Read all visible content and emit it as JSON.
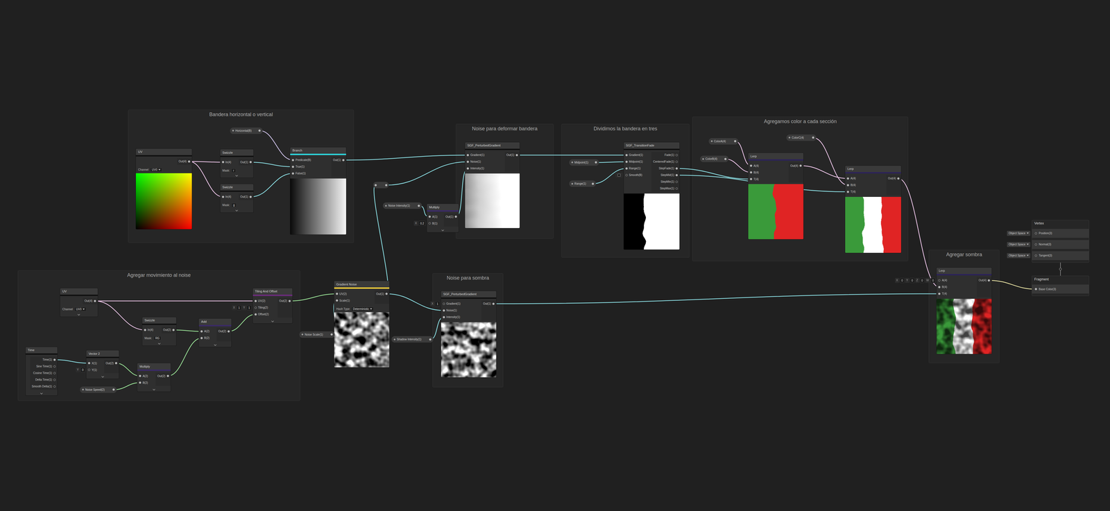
{
  "groups": [
    {
      "title": "Bandera horizontal o vertical"
    },
    {
      "title": "Noise para deformar bandera"
    },
    {
      "title": "Dividimos la bandera en tres"
    },
    {
      "title": "Agregamos color a cada sección"
    },
    {
      "title": "Agregar movimiento al noise"
    },
    {
      "title": "Noise para sombra"
    },
    {
      "title": "Agregar sombra"
    }
  ],
  "nodes": [
    {
      "kind": "node",
      "title": "UV",
      "strip": "#111111",
      "inputs": [],
      "outputs": [
        {
          "label": "Out(4)"
        }
      ],
      "fields": [
        {
          "label": "Channel",
          "value": "UV0",
          "dropdown": true
        }
      ],
      "preview": "uv"
    },
    {
      "kind": "node",
      "title": "Swizzle",
      "strip": "#111111",
      "inputs": [
        {
          "label": "In(4)"
        }
      ],
      "outputs": [
        {
          "label": "Out(1)"
        }
      ],
      "fields": [
        {
          "label": "Mask:",
          "value": "r",
          "dropdown": false
        }
      ],
      "preview": "none"
    },
    {
      "kind": "node",
      "title": "Swizzle",
      "strip": "#111111",
      "inputs": [
        {
          "label": "In(4)"
        }
      ],
      "outputs": [
        {
          "label": "Out(1)"
        }
      ],
      "fields": [
        {
          "label": "Mask:",
          "value": "g",
          "dropdown": false
        }
      ],
      "preview": "none"
    },
    {
      "kind": "node",
      "title": "Branch",
      "strip": "#2ed3d9",
      "inputs": [
        {
          "label": "Predicate(B)"
        },
        {
          "label": "True(1)"
        },
        {
          "label": "False(1)"
        }
      ],
      "outputs": [
        {
          "label": "Out(1)"
        }
      ],
      "fields": [],
      "preview": "hgradient"
    },
    {
      "kind": "property",
      "label": "Horizontal(B)"
    },
    {
      "kind": "node",
      "title": "SGF_PerturbedGradient",
      "strip": "#111111",
      "inputs": [
        {
          "label": "Gradient(1)"
        },
        {
          "label": "Noise(1)"
        },
        {
          "label": "Intensity(1)"
        }
      ],
      "outputs": [
        {
          "label": "Out(1)"
        }
      ],
      "fields": [],
      "preview": "perturbed"
    },
    {
      "kind": "property",
      "label": "Noise Intensity(1)"
    },
    {
      "kind": "node",
      "title": "Multiply",
      "strip": "#3a2a66",
      "inputs": [
        {
          "label": "A(1)"
        },
        {
          "label": "B(1)",
          "field": [
            "X",
            "0.2"
          ]
        }
      ],
      "outputs": [
        {
          "label": "Out(1)"
        }
      ],
      "fields": [],
      "preview": "none"
    },
    {
      "kind": "redirect"
    },
    {
      "kind": "property",
      "label": "Midpoint(1)"
    },
    {
      "kind": "property",
      "label": "Range(1)"
    },
    {
      "kind": "node",
      "title": "SGF_TransitionFade",
      "strip": "#111111",
      "inputs": [
        {
          "label": "Gradient(1)"
        },
        {
          "label": "Midpoint(1)"
        },
        {
          "label": "Range(1)"
        },
        {
          "label": "Smooth(B)",
          "check": false
        }
      ],
      "outputs": [
        {
          "label": "Fade(1)"
        },
        {
          "label": "CenteredFade(1)"
        },
        {
          "label": "StepFade(1)"
        },
        {
          "label": "StepMid(1)"
        },
        {
          "label": "StepMin(1)"
        },
        {
          "label": "StepMax(1)"
        }
      ],
      "fields": [],
      "preview": "step"
    },
    {
      "kind": "property",
      "label": "ColorA(4)"
    },
    {
      "kind": "property",
      "label": "ColorB(4)"
    },
    {
      "kind": "property",
      "label": "ColorC(4)"
    },
    {
      "kind": "node",
      "title": "Lerp",
      "strip": "#2c2358",
      "inputs": [
        {
          "label": "A(4)"
        },
        {
          "label": "B(4)"
        },
        {
          "label": "T(4)"
        }
      ],
      "outputs": [
        {
          "label": "Out(4)"
        }
      ],
      "fields": [],
      "preview": "lerp2"
    },
    {
      "kind": "node",
      "title": "Lerp",
      "strip": "#2c2358",
      "inputs": [
        {
          "label": "A(4)"
        },
        {
          "label": "B(4)"
        },
        {
          "label": "T(4)"
        }
      ],
      "outputs": [
        {
          "label": "Out(4)"
        }
      ],
      "fields": [],
      "preview": "flag"
    },
    {
      "kind": "node",
      "title": "UV",
      "strip": "#111111",
      "inputs": [],
      "outputs": [
        {
          "label": "Out(4)"
        }
      ],
      "fields": [
        {
          "label": "Channel",
          "value": "UV0",
          "dropdown": true
        }
      ],
      "preview": "none"
    },
    {
      "kind": "node",
      "title": "Swizzle",
      "strip": "#111111",
      "inputs": [
        {
          "label": "In(4)"
        }
      ],
      "outputs": [
        {
          "label": "Out(2)"
        }
      ],
      "fields": [
        {
          "label": "Mask:",
          "value": "RG",
          "dropdown": false
        }
      ],
      "preview": "none"
    },
    {
      "kind": "node",
      "title": "Time",
      "strip": "#111111",
      "inputs": [],
      "outputs": [
        {
          "label": "Time(1)"
        },
        {
          "label": "Sine Time(1)"
        },
        {
          "label": "Cosine Time(1)"
        },
        {
          "label": "Delta Time(1)"
        },
        {
          "label": "Smooth Delta(1)"
        }
      ],
      "fields": [],
      "preview": "none"
    },
    {
      "kind": "node",
      "title": "Vector 2",
      "strip": "#111111",
      "inputs": [
        {
          "label": "X(1)"
        },
        {
          "label": "Y(1)",
          "field": [
            "Y",
            "0"
          ]
        }
      ],
      "outputs": [
        {
          "label": "Out(2)"
        }
      ],
      "fields": [],
      "preview": "none"
    },
    {
      "kind": "node",
      "title": "Multiply",
      "strip": "#3a2a66",
      "inputs": [
        {
          "label": "A(2)"
        },
        {
          "label": "B(2)"
        }
      ],
      "outputs": [
        {
          "label": "Out(2)"
        }
      ],
      "fields": [],
      "preview": "none"
    },
    {
      "kind": "property",
      "label": "Noise Speed(2)"
    },
    {
      "kind": "node",
      "title": "Add",
      "strip": "#3a2a66",
      "inputs": [
        {
          "label": "A(2)"
        },
        {
          "label": "B(2)"
        }
      ],
      "outputs": [
        {
          "label": "Out(2)"
        }
      ],
      "fields": [],
      "preview": "none"
    },
    {
      "kind": "node",
      "title": "Tiling And Offset",
      "strip": "#6a2c7a",
      "inputs": [
        {
          "label": "UV(2)"
        },
        {
          "label": "Tiling(2)",
          "field": [
            "X",
            "1",
            "Y",
            "1"
          ]
        },
        {
          "label": "Offset(2)"
        }
      ],
      "outputs": [
        {
          "label": "Out(2)"
        }
      ],
      "fields": [],
      "preview": "none"
    },
    {
      "kind": "node",
      "title": "Gradient Noise",
      "strip": "#e8c53a",
      "inputs": [
        {
          "label": "UV(2)"
        },
        {
          "label": "Scale(1)"
        }
      ],
      "outputs": [
        {
          "label": "Out(1)"
        }
      ],
      "fields": [
        {
          "label": "Hash Type",
          "value": "Deterministic",
          "dropdown": true
        }
      ],
      "preview": "noise"
    },
    {
      "kind": "property",
      "label": "Noise Scale(1)"
    },
    {
      "kind": "node",
      "title": "SGF_PerturbedGradient",
      "strip": "#111111",
      "inputs": [
        {
          "label": "Gradient(1)",
          "field": [
            "X",
            "1"
          ]
        },
        {
          "label": "Noise(1)"
        },
        {
          "label": "Intensity(1)"
        }
      ],
      "outputs": [
        {
          "label": "Out(1)"
        }
      ],
      "fields": [],
      "preview": "noise"
    },
    {
      "kind": "property",
      "label": "Shadow Intensity(1)"
    },
    {
      "kind": "node",
      "title": "Lerp",
      "strip": "#2c2358",
      "inputs": [
        {
          "label": "A(4)",
          "field": [
            "X",
            "0",
            "Y",
            "0",
            "Z",
            "0",
            "W",
            "0"
          ]
        },
        {
          "label": "B(4)"
        },
        {
          "label": "T(4)"
        }
      ],
      "outputs": [
        {
          "label": "Out(4)"
        }
      ],
      "fields": [],
      "preview": "flagshadow"
    },
    {
      "kind": "stack",
      "title": "Vertex",
      "inputs": [
        {
          "label": "Position(3)",
          "field": [
            "Object Space"
          ]
        },
        {
          "label": "Normal(3)",
          "field": [
            "Object Space"
          ]
        },
        {
          "label": "Tangent(3)",
          "field": [
            "Object Space"
          ]
        }
      ]
    },
    {
      "kind": "stack",
      "title": "Fragment",
      "inputs": [
        {
          "label": "Base Color(3)"
        }
      ]
    }
  ],
  "edges": [
    {
      "from": [
        0,
        0
      ],
      "to": [
        1,
        0
      ],
      "color": "#f0c8ec"
    },
    {
      "from": [
        0,
        0
      ],
      "to": [
        2,
        0
      ],
      "color": "#f0c8ec"
    },
    {
      "from": [
        4,
        0
      ],
      "to": [
        3,
        0
      ],
      "color": "#d6c9f2"
    },
    {
      "from": [
        1,
        0
      ],
      "to": [
        3,
        1
      ],
      "color": "#8ee3e8"
    },
    {
      "from": [
        2,
        0
      ],
      "to": [
        3,
        2
      ],
      "color": "#8ee3e8"
    },
    {
      "from": [
        3,
        0
      ],
      "to": [
        5,
        0
      ],
      "color": "#8ee3e8"
    },
    {
      "from": [
        25,
        0
      ],
      "to": [
        8,
        0
      ],
      "color": "#8ee3e8"
    },
    {
      "from": [
        8,
        0
      ],
      "to": [
        5,
        1
      ],
      "color": "#8ee3e8"
    },
    {
      "from": [
        6,
        0
      ],
      "to": [
        7,
        0
      ],
      "color": "#8ee3e8"
    },
    {
      "from": [
        7,
        0
      ],
      "to": [
        5,
        2
      ],
      "color": "#8ee3e8"
    },
    {
      "from": [
        5,
        0
      ],
      "to": [
        11,
        0
      ],
      "color": "#8ee3e8"
    },
    {
      "from": [
        9,
        0
      ],
      "to": [
        11,
        1
      ],
      "color": "#8ee3e8"
    },
    {
      "from": [
        10,
        0
      ],
      "to": [
        11,
        2
      ],
      "color": "#8ee3e8"
    },
    {
      "from": [
        12,
        0
      ],
      "to": [
        15,
        0
      ],
      "color": "#f0c8ec"
    },
    {
      "from": [
        13,
        0
      ],
      "to": [
        15,
        1
      ],
      "color": "#f0c8ec"
    },
    {
      "from": [
        11,
        2
      ],
      "to": [
        15,
        2
      ],
      "color": "#8ee3e8"
    },
    {
      "from": [
        15,
        0
      ],
      "to": [
        16,
        0
      ],
      "color": "#f0c8ec"
    },
    {
      "from": [
        14,
        0
      ],
      "to": [
        16,
        1
      ],
      "color": "#f0c8ec"
    },
    {
      "from": [
        11,
        3
      ],
      "to": [
        16,
        2
      ],
      "color": "#8ee3e8"
    },
    {
      "from": [
        16,
        0
      ],
      "to": [
        29,
        1
      ],
      "color": "#f0c8ec"
    },
    {
      "from": [
        27,
        0
      ],
      "to": [
        29,
        2
      ],
      "color": "#8ee3e8"
    },
    {
      "from": [
        29,
        0
      ],
      "to": [
        31,
        0
      ],
      "color": "#efe9a8"
    },
    {
      "from": [
        17,
        0
      ],
      "to": [
        24,
        0
      ],
      "color": "#f0c8ec"
    },
    {
      "from": [
        17,
        0
      ],
      "to": [
        18,
        0
      ],
      "color": "#f0c8ec"
    },
    {
      "from": [
        19,
        0
      ],
      "to": [
        20,
        0
      ],
      "color": "#8ee3e8"
    },
    {
      "from": [
        20,
        0
      ],
      "to": [
        21,
        0
      ],
      "color": "#9de89a"
    },
    {
      "from": [
        22,
        0
      ],
      "to": [
        21,
        1
      ],
      "color": "#9de89a"
    },
    {
      "from": [
        18,
        0
      ],
      "to": [
        23,
        0
      ],
      "color": "#9de89a"
    },
    {
      "from": [
        21,
        0
      ],
      "to": [
        23,
        1
      ],
      "color": "#9de89a"
    },
    {
      "from": [
        23,
        0
      ],
      "to": [
        24,
        2
      ],
      "color": "#9de89a"
    },
    {
      "from": [
        24,
        0
      ],
      "to": [
        25,
        0
      ],
      "color": "#9de89a"
    },
    {
      "from": [
        26,
        0
      ],
      "to": [
        25,
        1
      ],
      "color": "#8ee3e8"
    },
    {
      "from": [
        25,
        0
      ],
      "to": [
        27,
        1
      ],
      "color": "#8ee3e8"
    },
    {
      "from": [
        28,
        0
      ],
      "to": [
        27,
        2
      ],
      "color": "#8ee3e8"
    }
  ]
}
